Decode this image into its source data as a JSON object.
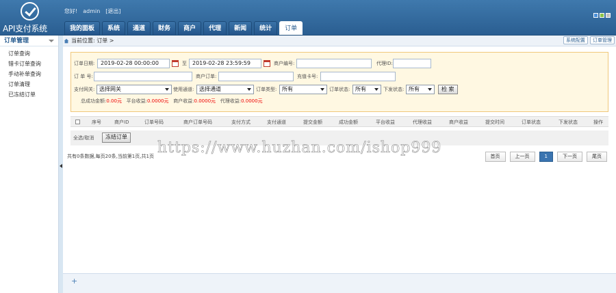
{
  "logo": {
    "text": "API支付系统"
  },
  "header": {
    "greeting": "您好!",
    "user": "admin",
    "logout": "[退出]"
  },
  "nav": [
    "我的面板",
    "系统",
    "通道",
    "财务",
    "商户",
    "代理",
    "新闻",
    "统计",
    "订单"
  ],
  "nav_active": "订单",
  "skin_colors": [
    "#4a90d9",
    "#8bc34a",
    "#c0c0c0"
  ],
  "sidebar": {
    "title": "订单管理",
    "items": [
      "订单查询",
      "错卡订单查询",
      "手动补单查询",
      "订单清理",
      "已冻结订单"
    ]
  },
  "breadcrumb": {
    "text": "当前位置: 订单 >",
    "btn1": "系统配置",
    "btn2": "订单管理"
  },
  "filter": {
    "date_label": "订单日期:",
    "date_from": "2019-02-28 00:00:00",
    "to": "至",
    "date_to": "2019-02-28 23:59:59",
    "merchant_no_label": "商户编号:",
    "agent_id_label": "代理ID:",
    "order_no_label": "订 单 号:",
    "merchant_order_label": "商户订单:",
    "card_no_label": "充值卡号:",
    "gateway_label": "支付网关:",
    "gateway_value": "选择网关",
    "channel_label": "使用通道:",
    "channel_value": "选择通道",
    "type_label": "订单类型:",
    "type_value": "所有",
    "status_label": "订单状态:",
    "status_value": "所有",
    "notify_label": "下发状态:",
    "notify_value": "所有",
    "search_btn": "检 索"
  },
  "summary": {
    "success_label": "总成功金额:",
    "success_value": "0.00元",
    "platform_label": "平台收益:",
    "platform_value": "0.0000元",
    "merchant_label": "商户收益:",
    "merchant_value": "0.0000元",
    "agent_label": "代理收益:",
    "agent_value": "0.0000元"
  },
  "table": {
    "headers": [
      "序号",
      "商户ID",
      "订单号码",
      "商户订单号码",
      "支付方式",
      "支付通道",
      "提交金额",
      "成功金额",
      "平台收益",
      "代理收益",
      "商户收益",
      "提交时间",
      "订单状态",
      "下发状态",
      "操作"
    ]
  },
  "ops": {
    "select_all": "全选/取消",
    "freeze_btn": "冻结订单"
  },
  "pagination": {
    "info": "共有0条数据,每页20条,当前第1页,共1页",
    "first": "首页",
    "prev": "上一页",
    "current": "1",
    "next": "下一页",
    "last": "尾页"
  },
  "watermark": "https://www.huzhan.com/ishop999"
}
